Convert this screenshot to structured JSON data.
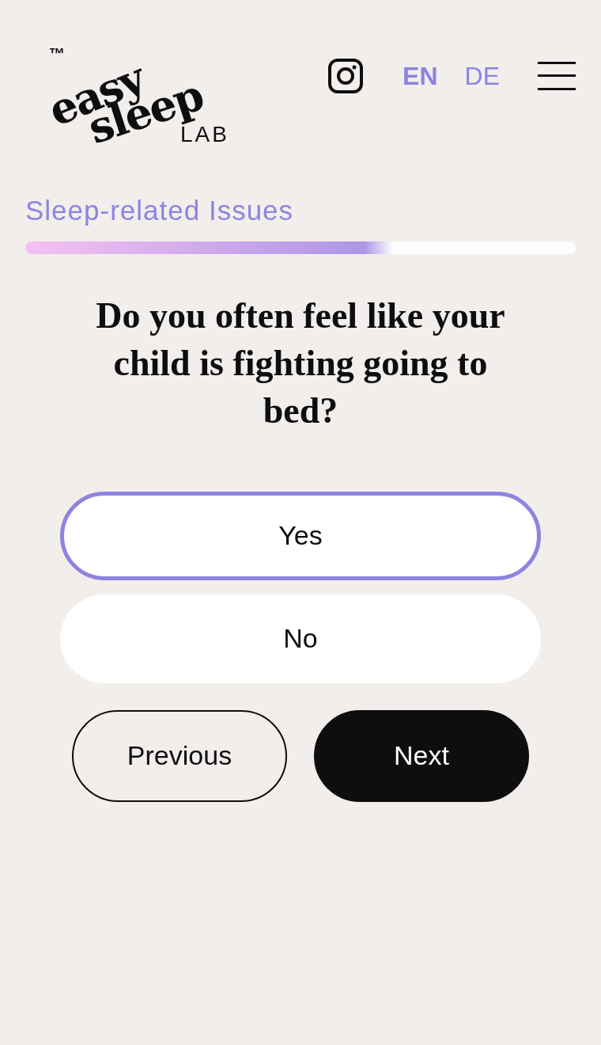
{
  "logo": {
    "trademark": "™",
    "line_1": "easy",
    "line_2": "sleep",
    "line_3": "LAB"
  },
  "languages": [
    {
      "label": "EN",
      "selected": true
    },
    {
      "label": "DE",
      "selected": false
    }
  ],
  "section": {
    "title": "Sleep-related Issues",
    "level": 0.67
  },
  "question": "Do you often feel like your child is fighting going to bed?",
  "options": [
    {
      "label": "Yes",
      "selected": true
    },
    {
      "label": "No",
      "selected": false
    }
  ],
  "buttons": [
    {
      "label": "Previous",
      "kind": "outline"
    },
    {
      "label": "Next",
      "kind": "solid"
    }
  ]
}
